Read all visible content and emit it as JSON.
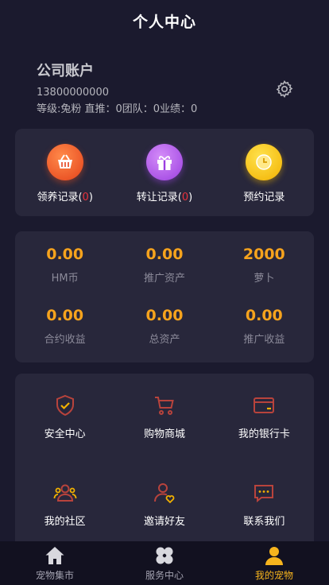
{
  "header": {
    "title": "个人中心"
  },
  "profile": {
    "name": "公司账户",
    "phone": "13800000000",
    "stats": "等级:兔粉 直推：0团队：0业绩：0"
  },
  "records": [
    {
      "label": "领养记录",
      "count": "0",
      "color": "#e4421a",
      "icon": "basket-icon"
    },
    {
      "label": "转让记录",
      "count": "0",
      "color": "#9b3fe0",
      "icon": "gift-icon"
    },
    {
      "label": "预约记录",
      "count": "",
      "color": "#f2b100",
      "icon": "clock-icon"
    }
  ],
  "assets": [
    {
      "value": "0.00",
      "label": "HM币"
    },
    {
      "value": "0.00",
      "label": "推广资产"
    },
    {
      "value": "2000",
      "label": "萝卜"
    },
    {
      "value": "0.00",
      "label": "合约收益"
    },
    {
      "value": "0.00",
      "label": "总资产"
    },
    {
      "value": "0.00",
      "label": "推广收益"
    }
  ],
  "menu": [
    {
      "label": "安全中心",
      "icon": "shield-icon"
    },
    {
      "label": "购物商城",
      "icon": "cart-icon"
    },
    {
      "label": "我的银行卡",
      "icon": "card-icon"
    },
    {
      "label": "我的社区",
      "icon": "community-icon"
    },
    {
      "label": "邀请好友",
      "icon": "invite-icon"
    },
    {
      "label": "联系我们",
      "icon": "chat-icon"
    }
  ],
  "tabs": [
    {
      "label": "宠物集市",
      "icon": "home-icon",
      "active": false
    },
    {
      "label": "服务中心",
      "icon": "clover-icon",
      "active": false
    },
    {
      "label": "我的宠物",
      "icon": "user-icon",
      "active": true
    }
  ],
  "colors": {
    "accent": "#f6a31d",
    "background": "#1b1a2e",
    "card": "#28273b",
    "active_tab": "#f6b41d"
  }
}
